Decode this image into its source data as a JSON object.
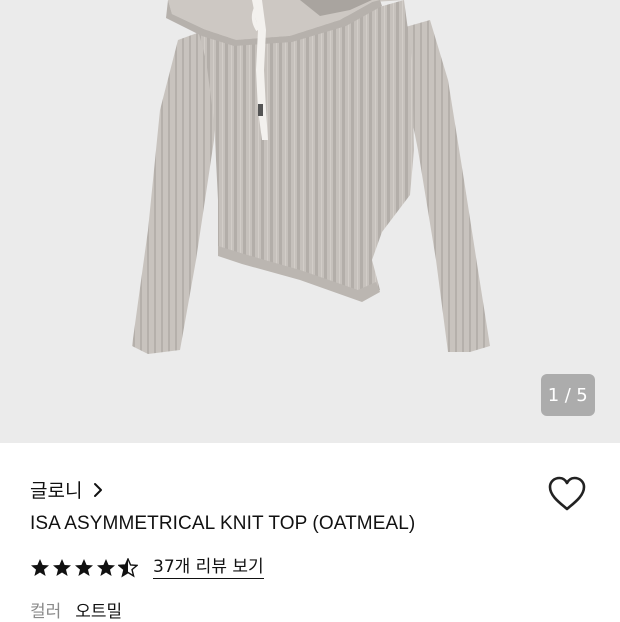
{
  "gallery": {
    "current_page": "1",
    "separator": "/",
    "total_pages": "5",
    "image_subject": "sweater-photo"
  },
  "product": {
    "brand": "글로니",
    "title": "ISA ASYMMETRICAL KNIT TOP (OATMEAL)",
    "rating": 4.5,
    "rating_max": 5,
    "review_link": "37개 리뷰 보기",
    "color_label": "컬러",
    "color_value": "오트밀"
  },
  "icons": {
    "brand_arrow": "chevron-right-icon",
    "wishlist": "heart-outline-icon",
    "rating": "star-icon"
  },
  "colors": {
    "gallery_bg": "#ebebeb",
    "sweater": "#c4bfba",
    "text": "#111111",
    "muted": "#8a8a8a",
    "counter_bg": "#787878"
  }
}
